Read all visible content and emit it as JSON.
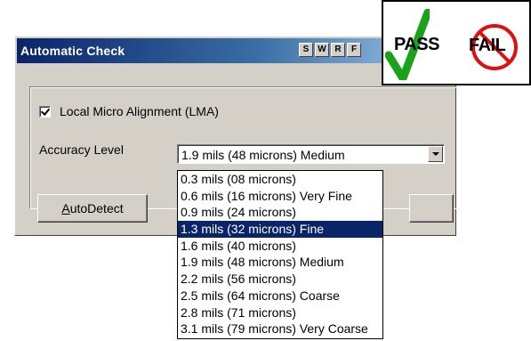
{
  "dialog": {
    "title": "Automatic Check",
    "title_buttons": [
      "S",
      "W",
      "R",
      "F"
    ],
    "lma_checkbox": {
      "label": "Local Micro Alignment (LMA)",
      "checked": true
    },
    "accuracy": {
      "label": "Accuracy Level",
      "selected": "1.9 mils (48 microns) Medium",
      "options": [
        "0.3 mils (08 microns)",
        "0.6 mils (16 microns) Very Fine",
        "0.9 mils (24 microns)",
        "1.3 mils (32 microns) Fine",
        "1.6 mils (40 microns)",
        "1.9 mils (48 microns) Medium",
        "2.2 mils (56 microns)",
        "2.5 mils (64 microns) Coarse",
        "2.8 mils (71 microns)",
        "3.1 mils (79 microns) Very Coarse"
      ],
      "highlighted_option": "1.3 mils (32 microns) Fine"
    },
    "autodetect_label": "AutoDetect"
  },
  "badge": {
    "pass_label": "PASS",
    "fail_label": "FAIL",
    "pass_icon": "checkmark-icon",
    "fail_icon": "prohibited-icon",
    "pass_color": "#1aa31a",
    "fail_color": "#e01010"
  }
}
